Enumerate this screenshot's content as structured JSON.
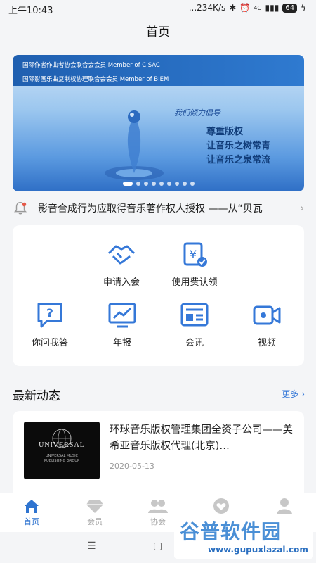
{
  "status_bar": {
    "time": "上午10:43",
    "network_speed": "...234K/s",
    "network_type": "4G",
    "battery": "64"
  },
  "header": {
    "title": "首页"
  },
  "banner": {
    "line1": "国际作者作曲者协会联合会会员 Member of CISAC",
    "line2": "国际影画乐曲复制权协理联合会会员 Member of BIEM",
    "slogan": "我们倾力倡导",
    "motto1": "尊重版权",
    "motto2": "让音乐之树常青",
    "motto3": "让音乐之泉常流",
    "slide_count": 9,
    "active_slide": 0
  },
  "notice": {
    "icon": "bell-icon",
    "text": "影音合成行为应取得音乐著作权人授权 ——从“贝瓦"
  },
  "menu": {
    "items": [
      {
        "label": "申请入会",
        "icon": "handshake-icon"
      },
      {
        "label": "使用费认领",
        "icon": "yen-claim-icon"
      },
      {
        "label": "你问我答",
        "icon": "question-chat-icon"
      },
      {
        "label": "年报",
        "icon": "report-chart-icon"
      },
      {
        "label": "会讯",
        "icon": "news-card-icon"
      },
      {
        "label": "视频",
        "icon": "video-camera-icon"
      }
    ]
  },
  "section": {
    "title": "最新动态",
    "more": "更多"
  },
  "news": [
    {
      "title": "环球音乐版权管理集团全资子公司——美希亚音乐版权代理(北京)…",
      "date": "2020-05-13",
      "thumb_brand": "UNIVERSAL",
      "thumb_sub1": "UNIVERSAL MUSIC",
      "thumb_sub2": "PUBLISHING GROUP"
    }
  ],
  "tabbar": {
    "tabs": [
      {
        "label": "首页",
        "icon": "home-icon",
        "active": true
      },
      {
        "label": "会员",
        "icon": "diamond-icon",
        "active": false
      },
      {
        "label": "协会",
        "icon": "group-icon",
        "active": false
      },
      {
        "label": "",
        "icon": "heart-icon",
        "active": false
      },
      {
        "label": "",
        "icon": "person-icon",
        "active": false
      }
    ]
  },
  "navbar": {
    "menu": "☰",
    "home": "▢"
  },
  "watermark": {
    "title": "谷普软件园",
    "url": "www.gupuxlazal.com"
  },
  "colors": {
    "accent": "#2f74d0",
    "icon_blue": "#3578d8"
  }
}
